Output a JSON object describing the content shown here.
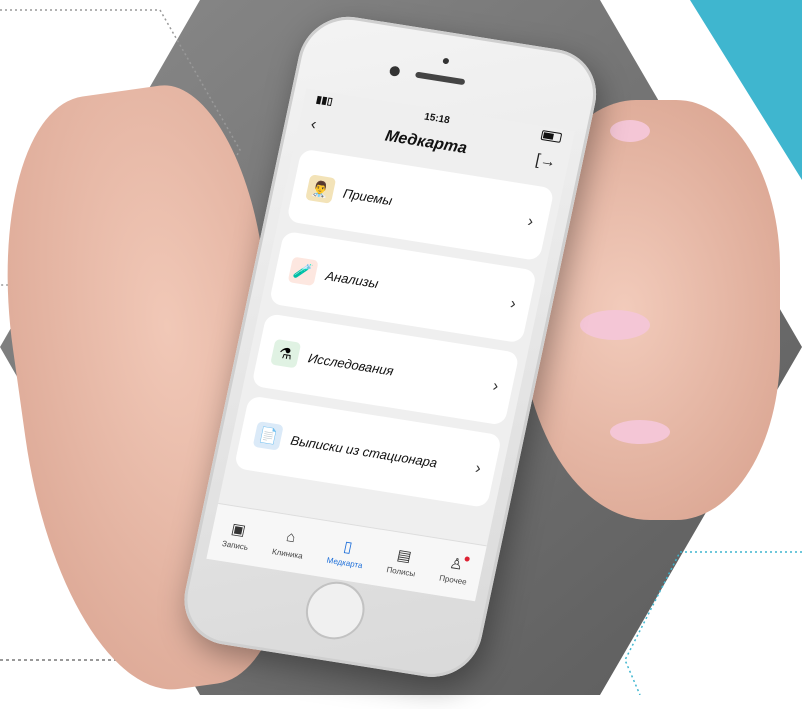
{
  "statusbar": {
    "time": "15:18"
  },
  "navbar": {
    "title": "Медкарта",
    "back_icon": "chevron-left-icon",
    "logout_icon": "logout-icon"
  },
  "menu": [
    {
      "label": "Приемы",
      "icon": "doctor-icon"
    },
    {
      "label": "Анализы",
      "icon": "test-tube-icon"
    },
    {
      "label": "Исследования",
      "icon": "flask-icon"
    },
    {
      "label": "Выписки из стационара",
      "icon": "document-icon"
    }
  ],
  "tabs": [
    {
      "label": "Запись",
      "icon": "calendar-icon"
    },
    {
      "label": "Клиника",
      "icon": "home-icon"
    },
    {
      "label": "Медкарта",
      "icon": "file-icon",
      "active": true
    },
    {
      "label": "Полисы",
      "icon": "card-icon"
    },
    {
      "label": "Прочее",
      "icon": "person-icon"
    }
  ],
  "colors": {
    "accent": "#1e6fd9",
    "teal": "#3fb6cf",
    "background_hex": "#6f6f6f"
  }
}
